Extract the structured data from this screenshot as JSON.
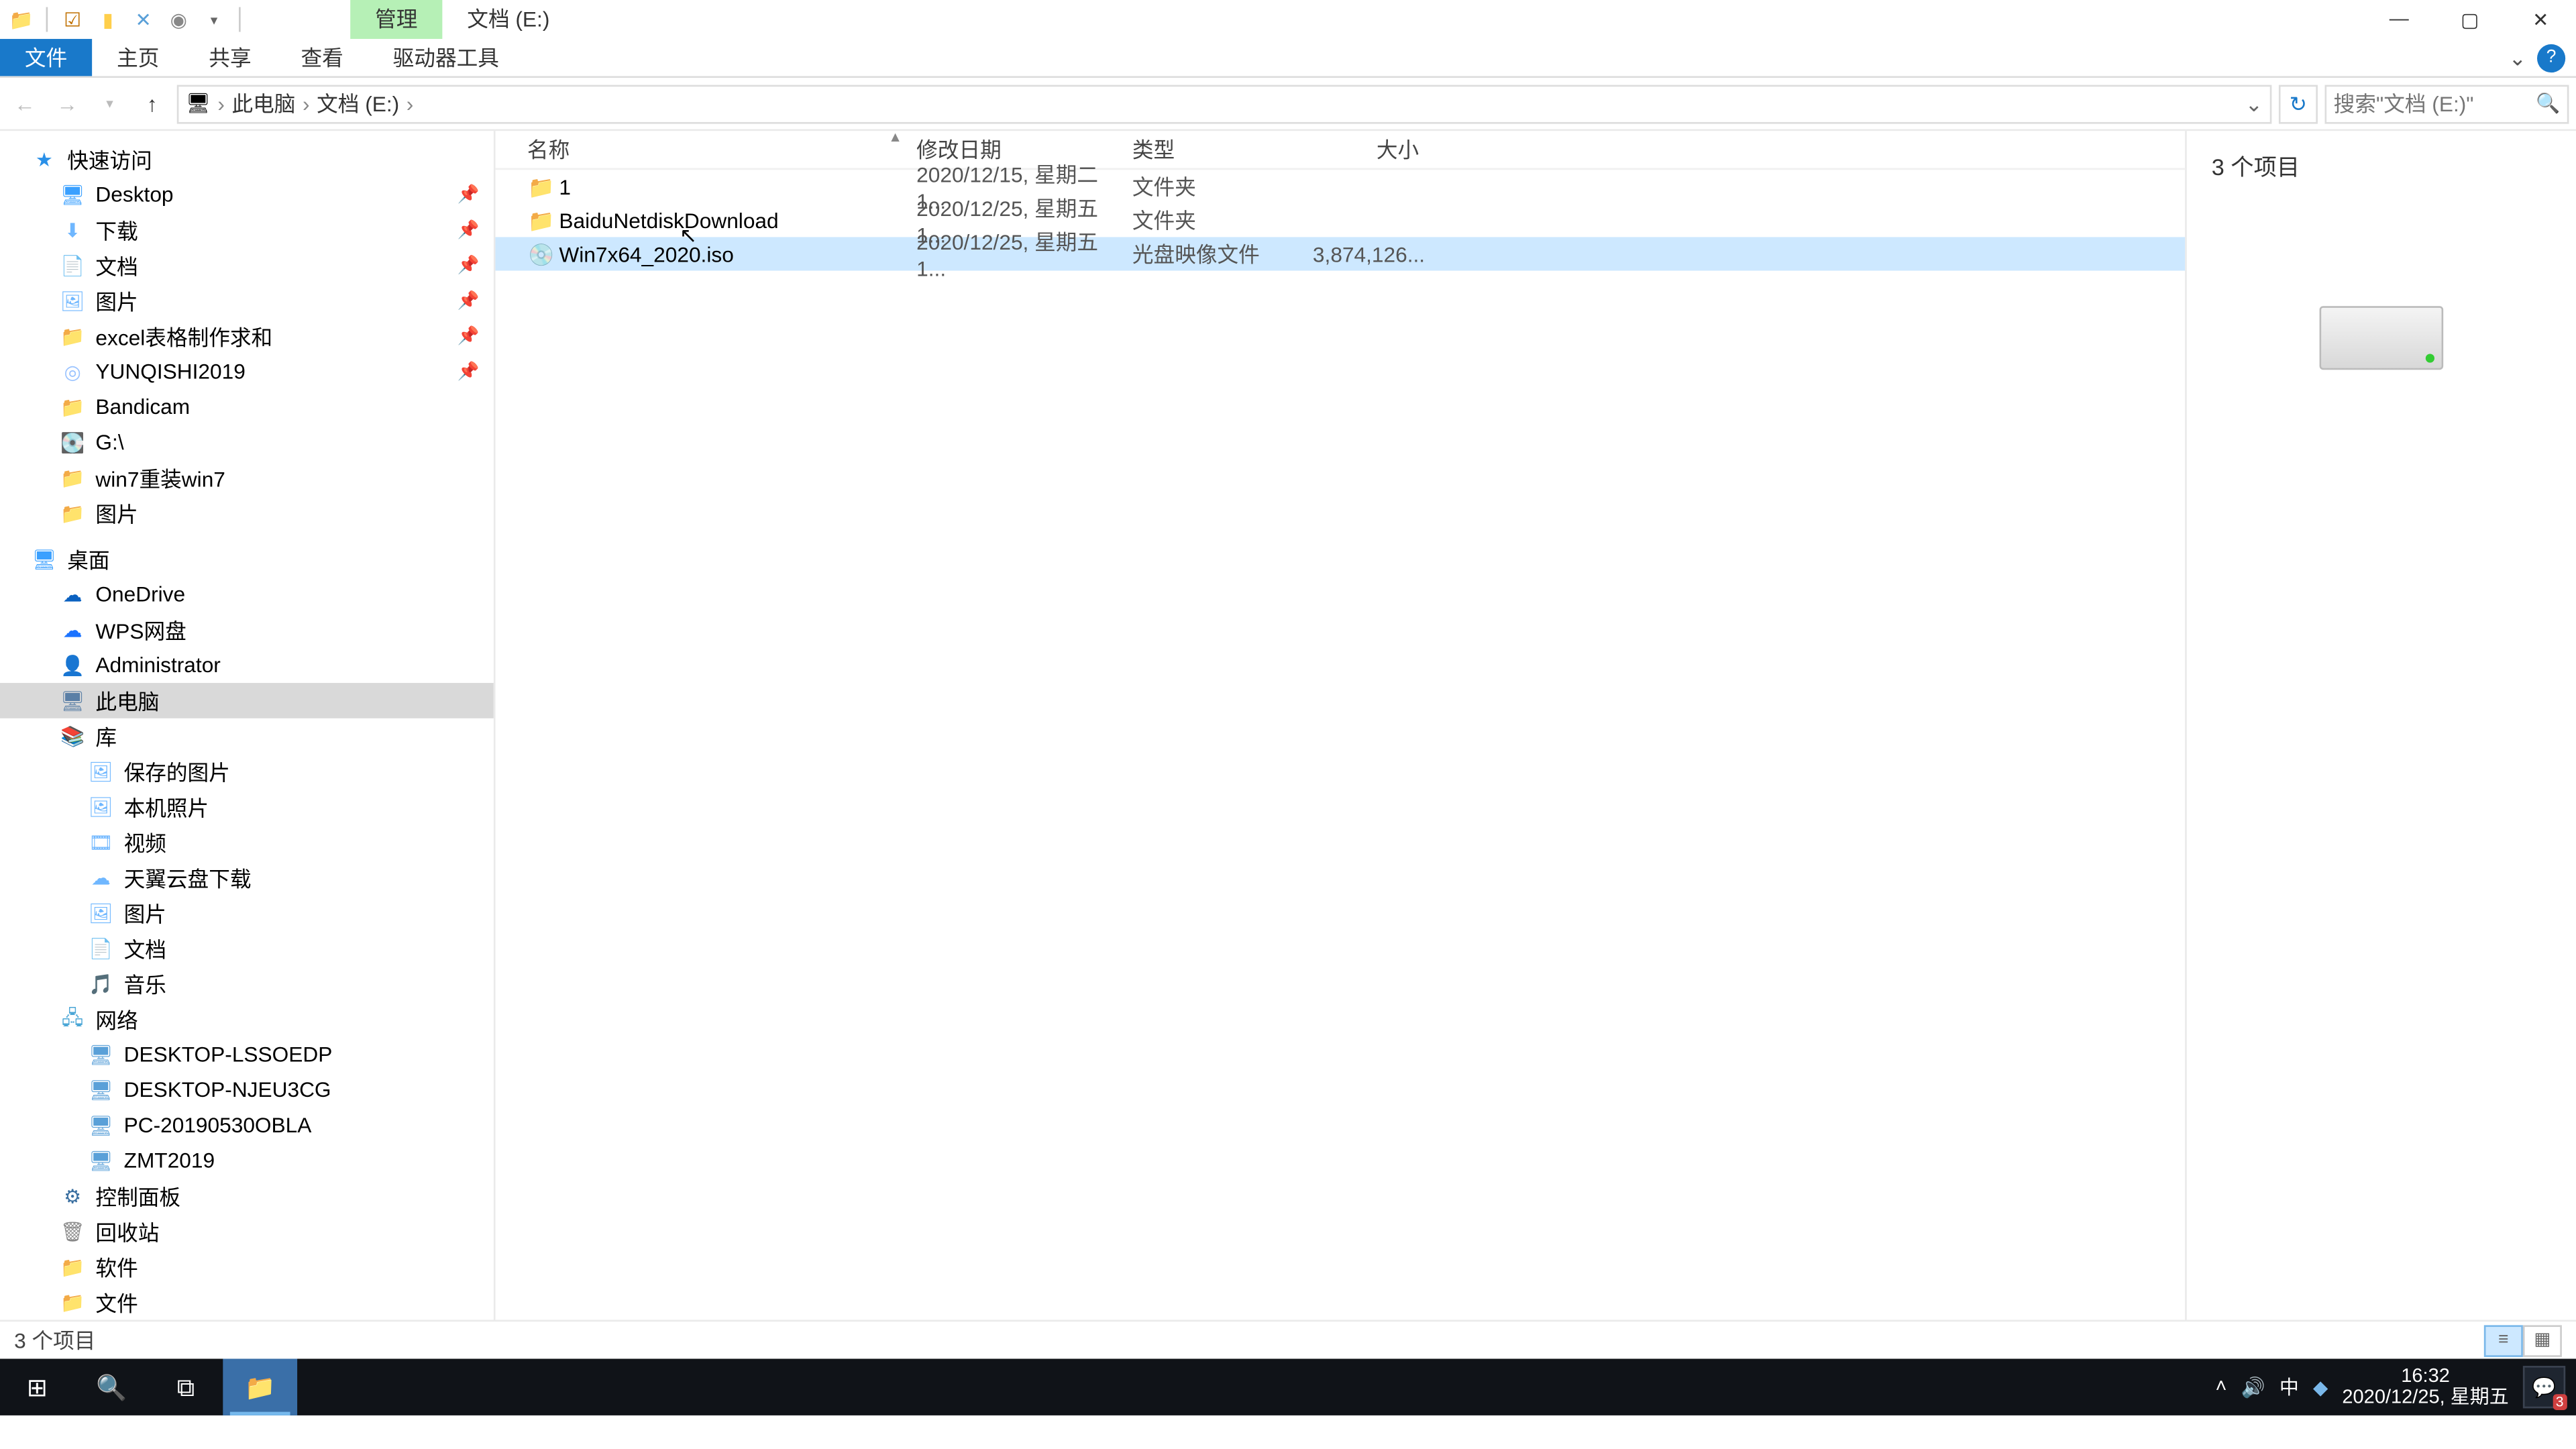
{
  "title": {
    "manage": "管理",
    "drive": "文档 (E:)"
  },
  "ribbon": {
    "file": "文件",
    "home": "主页",
    "share": "共享",
    "view": "查看",
    "drivetools": "驱动器工具"
  },
  "addr": {
    "thispc": "此电脑",
    "drive": "文档 (E:)"
  },
  "search": {
    "placeholder": "搜索\"文档 (E:)\""
  },
  "tree": {
    "quick": "快速访问",
    "pin": {
      "desktop": "Desktop",
      "downloads": "下载",
      "docs": "文档",
      "pics": "图片",
      "excel": "excel表格制作求和",
      "yun": "YUNQISHI2019",
      "band": "Bandicam",
      "g": "G:\\",
      "w7": "win7重装win7",
      "pics2": "图片"
    },
    "desktop": "桌面",
    "onedrive": "OneDrive",
    "wps": "WPS网盘",
    "admin": "Administrator",
    "thispc": "此电脑",
    "libs": "库",
    "lib": {
      "savedpics": "保存的图片",
      "localpics": "本机照片",
      "video": "视频",
      "sky": "天翼云盘下载",
      "pics": "图片",
      "docs": "文档",
      "music": "音乐"
    },
    "network": "网络",
    "net": {
      "n1": "DESKTOP-LSSOEDP",
      "n2": "DESKTOP-NJEU3CG",
      "n3": "PC-20190530OBLA",
      "n4": "ZMT2019"
    },
    "cp": "控制面板",
    "recycle": "回收站",
    "soft": "软件",
    "files": "文件"
  },
  "cols": {
    "name": "名称",
    "date": "修改日期",
    "type": "类型",
    "size": "大小"
  },
  "rows": [
    {
      "icon": "fold",
      "name": "1",
      "date": "2020/12/15, 星期二 1...",
      "type": "文件夹",
      "size": ""
    },
    {
      "icon": "fold",
      "name": "BaiduNetdiskDownload",
      "date": "2020/12/25, 星期五 1...",
      "type": "文件夹",
      "size": ""
    },
    {
      "icon": "iso",
      "name": "Win7x64_2020.iso",
      "date": "2020/12/25, 星期五 1...",
      "type": "光盘映像文件",
      "size": "3,874,126..."
    }
  ],
  "preview": {
    "count": "3 个项目"
  },
  "status": {
    "count": "3 个项目"
  },
  "taskbar": {
    "time": "16:32",
    "date": "2020/12/25, 星期五",
    "notif": "3",
    "ime": "中"
  }
}
